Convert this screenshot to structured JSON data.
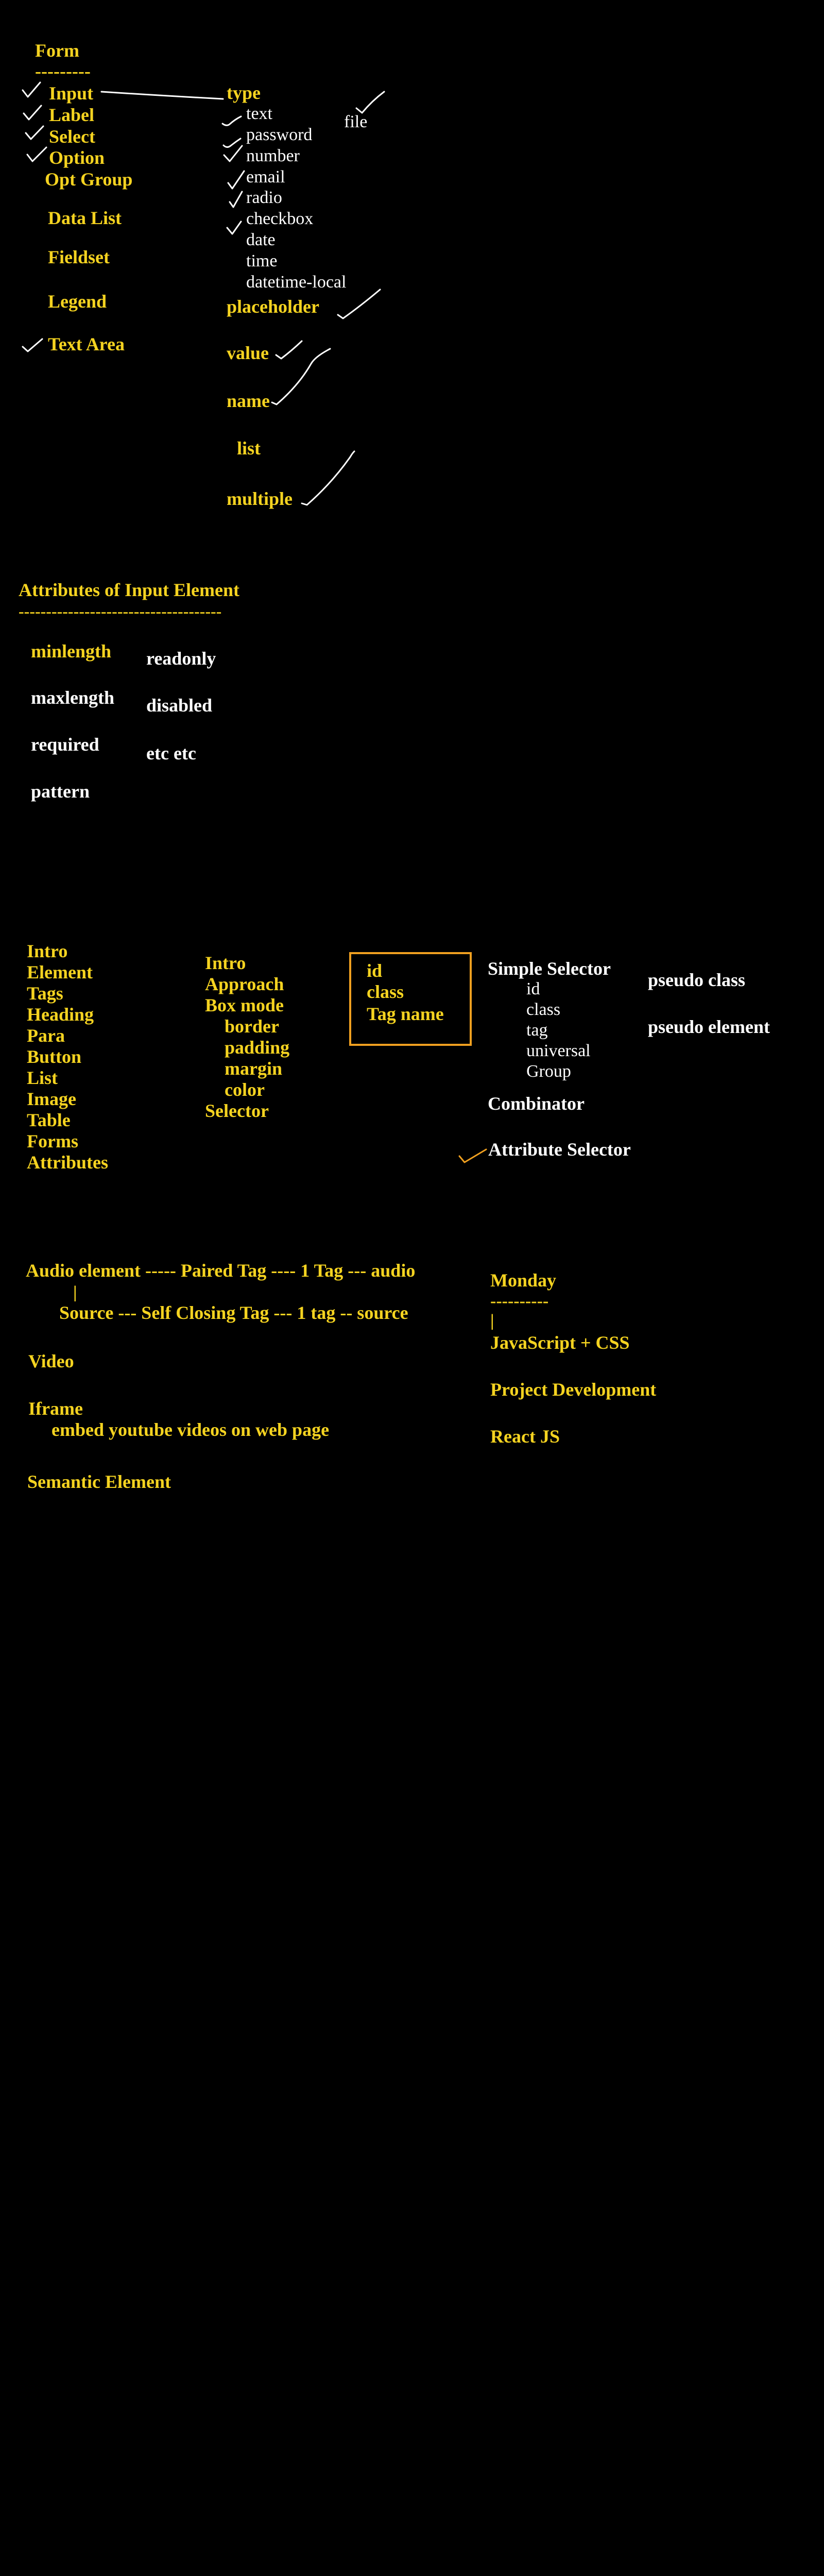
{
  "form_section": {
    "title": "Form",
    "underline": "---------",
    "elements": [
      "Input",
      "Label",
      "Select",
      "Option",
      "Opt Group",
      "Data List",
      "Fieldset",
      "Legend",
      "Text Area"
    ],
    "type_heading": "type",
    "types": [
      "text",
      "password",
      "number",
      "email",
      "radio",
      "checkbox",
      "date",
      "time",
      "datetime-local"
    ],
    "file": "file",
    "attributes": [
      "placeholder",
      "value",
      "name",
      "list",
      "multiple"
    ]
  },
  "input_attributes": {
    "title": "Attributes of Input Element",
    "underline": "-------------------------------------",
    "left": [
      "minlength",
      "maxlength",
      "required",
      "pattern"
    ],
    "right": [
      "readonly",
      "disabled",
      "etc etc"
    ]
  },
  "topics": {
    "html": [
      "Intro",
      "Element",
      "Tags",
      "Heading",
      "Para",
      "Button",
      "List",
      "Image",
      "Table",
      "Forms",
      "Attributes"
    ],
    "css": [
      "Intro",
      "Approach",
      "Box mode",
      "border",
      "padding",
      "margin",
      "color",
      "Selector"
    ],
    "boxed": [
      "id",
      "class",
      "Tag name"
    ]
  },
  "selectors": {
    "simple": "Simple Selector",
    "simple_items": [
      "id",
      "class",
      "tag",
      "universal",
      "Group"
    ],
    "combinator": "Combinator",
    "attribute": "Attribute Selector",
    "pseudo_class": "pseudo class",
    "pseudo_element": "pseudo element"
  },
  "media": {
    "audio": "Audio element ----- Paired Tag ---- 1 Tag --- audio",
    "pipe": "|",
    "source": "Source --- Self Closing Tag --- 1 tag -- source",
    "video": "Video",
    "iframe": "Iframe",
    "iframe_note": "embed youtube videos on web page",
    "semantic": "Semantic Element"
  },
  "plan": {
    "day": "Monday",
    "underline": "----------",
    "pipe": "|",
    "items": [
      "JavaScript + CSS",
      "Project Development",
      "React JS"
    ]
  },
  "colors": {
    "background": "#000000",
    "highlight": "#f5d320",
    "ink": "#ffffff",
    "box": "#f0a020"
  }
}
